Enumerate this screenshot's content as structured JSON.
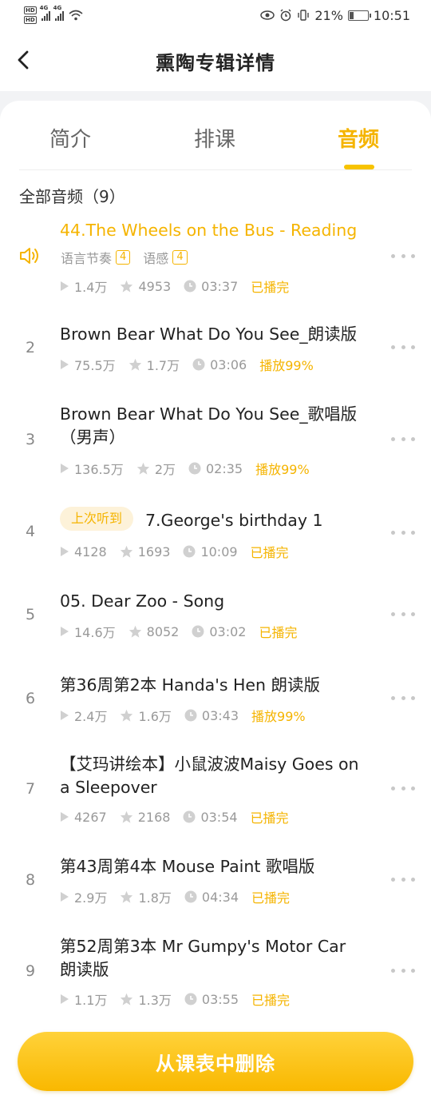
{
  "status_bar": {
    "battery": "21%",
    "time": "10:51",
    "net1": "4G",
    "net2": "4G"
  },
  "header": {
    "title": "熏陶专辑详情"
  },
  "tabs": [
    {
      "label": "简介"
    },
    {
      "label": "排课"
    },
    {
      "label": "音频"
    }
  ],
  "active_tab": "音频",
  "list": {
    "header": "全部音频（9）"
  },
  "tracks": [
    {
      "num": "",
      "title": "44.The Wheels on the Bus - Reading",
      "tags": [
        {
          "label": "语言节奏",
          "count": "4"
        },
        {
          "label": "语感",
          "count": "4"
        }
      ],
      "plays": "1.4万",
      "likes": "4953",
      "duration": "03:37",
      "status": "已播完"
    },
    {
      "num": "2",
      "title": "Brown Bear What Do You See_朗读版",
      "plays": "75.5万",
      "likes": "1.7万",
      "duration": "03:06",
      "status": "播放99%"
    },
    {
      "num": "3",
      "title": "Brown Bear What Do You See_歌唱版（男声）",
      "plays": "136.5万",
      "likes": "2万",
      "duration": "02:35",
      "status": "播放99%"
    },
    {
      "num": "4",
      "chip": "上次听到",
      "title": "7.George's birthday 1",
      "plays": "4128",
      "likes": "1693",
      "duration": "10:09",
      "status": "已播完"
    },
    {
      "num": "5",
      "title": "05. Dear Zoo - Song",
      "plays": "14.6万",
      "likes": "8052",
      "duration": "03:02",
      "status": "已播完"
    },
    {
      "num": "6",
      "title": "第36周第2本 Handa's Hen 朗读版",
      "plays": "2.4万",
      "likes": "1.6万",
      "duration": "03:43",
      "status": "播放99%"
    },
    {
      "num": "7",
      "title": "【艾玛讲绘本】小鼠波波Maisy Goes on a Sleepover",
      "plays": "4267",
      "likes": "2168",
      "duration": "03:54",
      "status": "已播完"
    },
    {
      "num": "8",
      "title": "第43周第4本 Mouse Paint 歌唱版",
      "plays": "2.9万",
      "likes": "1.8万",
      "duration": "04:34",
      "status": "已播完"
    },
    {
      "num": "9",
      "title": "第52周第3本 Mr Gumpy's Motor Car 朗读版",
      "plays": "1.1万",
      "likes": "1.3万",
      "duration": "03:55",
      "status": "已播完"
    }
  ],
  "footer": {
    "delete_label": "从课表中删除"
  },
  "colors": {
    "accent": "#f5b400",
    "chip_bg": "#fdf2d9",
    "muted": "#999999"
  }
}
